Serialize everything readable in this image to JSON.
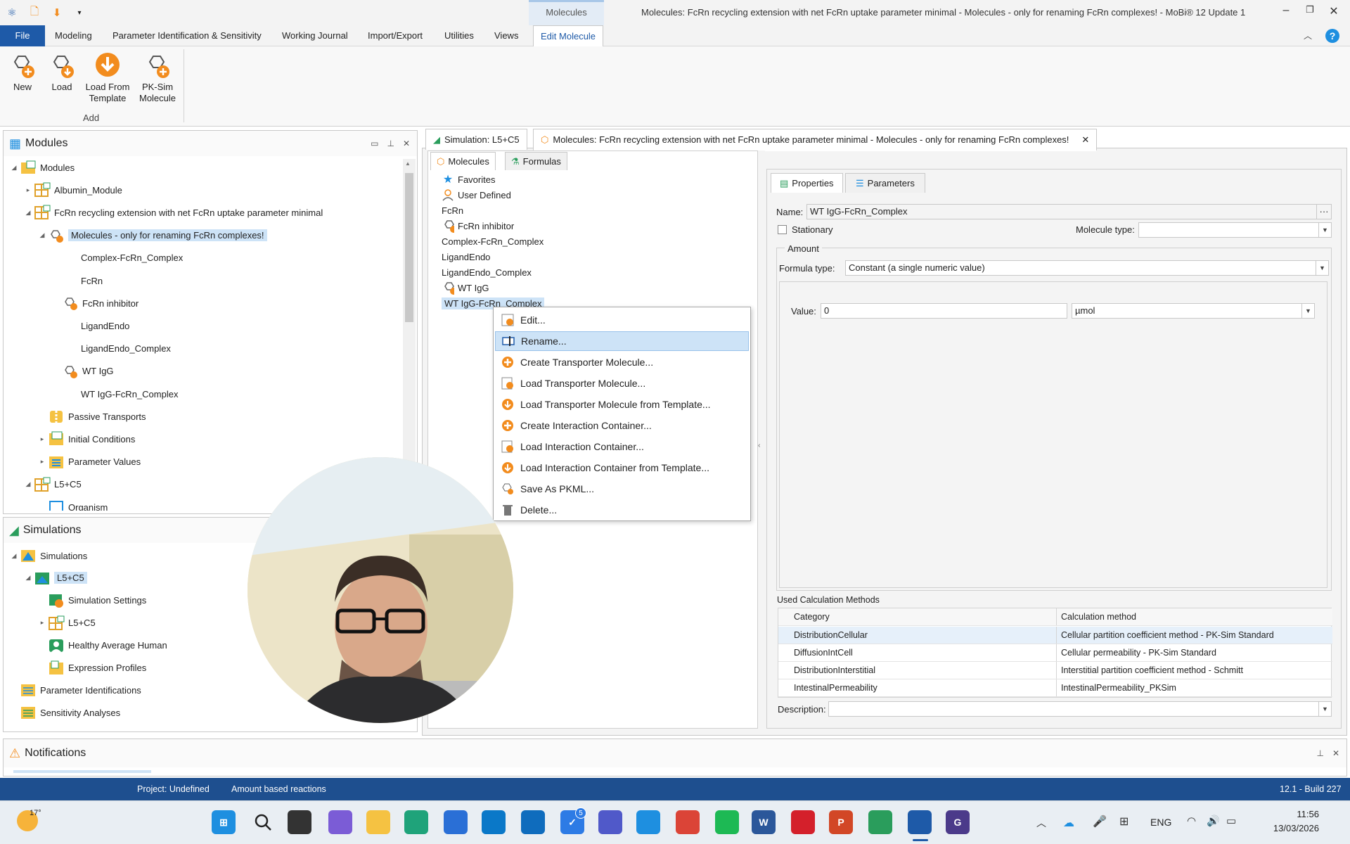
{
  "window": {
    "title": "Molecules: FcRn recycling extension with net FcRn uptake parameter minimal - Molecules - only for renaming FcRn complexes! - MoBi® 12 Update 1",
    "context_tab": "Molecules"
  },
  "menu": {
    "file": "File",
    "items": [
      "Modeling",
      "Parameter Identification & Sensitivity",
      "Working Journal",
      "Import/Export",
      "Utilities",
      "Views",
      "Edit Molecule"
    ]
  },
  "ribbon": {
    "buttons": [
      "New",
      "Load",
      "Load From\nTemplate",
      "PK-Sim\nMolecule"
    ],
    "group_label": "Add"
  },
  "modules_panel": {
    "title": "Modules",
    "tree": [
      {
        "label": "Modules",
        "level": 0,
        "expanded": true,
        "icon": "modules-folder-icon"
      },
      {
        "label": "Albumin_Module",
        "level": 1,
        "expanded": false,
        "icon": "module-icon"
      },
      {
        "label": "FcRn recycling extension with net FcRn uptake parameter minimal",
        "level": 1,
        "expanded": true,
        "icon": "module-icon"
      },
      {
        "label": "Molecules - only for renaming FcRn complexes!",
        "level": 2,
        "expanded": true,
        "selected": true,
        "icon": "molecule-icon"
      },
      {
        "label": "Complex-FcRn_Complex",
        "level": 3
      },
      {
        "label": "FcRn",
        "level": 3
      },
      {
        "label": "FcRn inhibitor",
        "level": 3,
        "icon": "molecule-icon"
      },
      {
        "label": "LigandEndo",
        "level": 3
      },
      {
        "label": "LigandEndo_Complex",
        "level": 3
      },
      {
        "label": "WT IgG",
        "level": 3,
        "icon": "molecule-icon"
      },
      {
        "label": "WT IgG-FcRn_Complex",
        "level": 3
      },
      {
        "label": "Passive Transports",
        "level": 2,
        "icon": "transport-icon"
      },
      {
        "label": "Initial Conditions",
        "level": 2,
        "expanded": false,
        "icon": "initial-conditions-icon"
      },
      {
        "label": "Parameter Values",
        "level": 2,
        "expanded": false,
        "icon": "parameter-values-icon"
      },
      {
        "label": "L5+C5",
        "level": 1,
        "expanded": true,
        "icon": "module-icon"
      },
      {
        "label": "Organism",
        "level": 2,
        "icon": "organism-icon"
      }
    ]
  },
  "simulations_panel": {
    "title": "Simulations",
    "tree": [
      {
        "label": "Simulations",
        "level": 0,
        "expanded": true,
        "icon": "simulations-icon"
      },
      {
        "label": "L5+C5",
        "level": 1,
        "expanded": true,
        "selected": true,
        "icon": "simulation-icon"
      },
      {
        "label": "Simulation Settings",
        "level": 2,
        "icon": "settings-icon"
      },
      {
        "label": "L5+C5",
        "level": 2,
        "expanded": false,
        "icon": "module-icon"
      },
      {
        "label": "Healthy Average Human",
        "level": 2,
        "icon": "individual-icon"
      },
      {
        "label": "Expression Profiles",
        "level": 2,
        "icon": "expression-icon"
      },
      {
        "label": "Parameter Identifications",
        "level": 0,
        "icon": "parameter-identification-icon"
      },
      {
        "label": "Sensitivity Analyses",
        "level": 0,
        "icon": "sensitivity-icon"
      }
    ]
  },
  "notifications": {
    "title": "Notifications"
  },
  "doc_tabs": [
    {
      "label": "Simulation: L5+C5"
    },
    {
      "label": "Molecules: FcRn recycling extension with net FcRn uptake parameter minimal - Molecules - only for renaming FcRn complexes!"
    }
  ],
  "sub_tabs": [
    "Molecules",
    "Formulas"
  ],
  "molecule_list": [
    {
      "label": "Favorites",
      "icon": "star-icon"
    },
    {
      "label": "User Defined",
      "icon": "user-defined-icon"
    },
    {
      "label": "FcRn"
    },
    {
      "label": "FcRn inhibitor",
      "icon": "molecule-icon"
    },
    {
      "label": "Complex-FcRn_Complex"
    },
    {
      "label": "LigandEndo"
    },
    {
      "label": "LigandEndo_Complex"
    },
    {
      "label": "WT IgG",
      "icon": "molecule-icon"
    },
    {
      "label": "WT IgG-FcRn_Complex",
      "selected": true
    }
  ],
  "context_menu": [
    {
      "label": "Edit...",
      "icon": "edit-icon"
    },
    {
      "label": "Rename...",
      "icon": "rename-icon",
      "highlighted": true
    },
    {
      "label": "Create Transporter Molecule...",
      "icon": "create-icon"
    },
    {
      "label": "Load Transporter Molecule...",
      "icon": "load-icon"
    },
    {
      "label": "Load Transporter Molecule from Template...",
      "icon": "template-icon"
    },
    {
      "label": "Create Interaction Container...",
      "icon": "create-icon"
    },
    {
      "label": "Load Interaction Container...",
      "icon": "load-icon"
    },
    {
      "label": "Load Interaction Container from Template...",
      "icon": "template-icon"
    },
    {
      "label": "Save As PKML...",
      "icon": "save-pkml-icon"
    },
    {
      "label": "Delete...",
      "icon": "trash-icon"
    }
  ],
  "properties": {
    "tabs": [
      "Properties",
      "Parameters"
    ],
    "name_label": "Name:",
    "name_value": "WT IgG-FcRn_Complex",
    "stationary_label": "Stationary",
    "molecule_type_label": "Molecule type:",
    "molecule_type_value": "",
    "amount_label": "Amount",
    "formula_type_label": "Formula type:",
    "formula_type_value": "Constant (a single numeric value)",
    "value_label": "Value:",
    "value": "0",
    "unit": "µmol",
    "used_calc_label": "Used Calculation Methods",
    "calc_headers": [
      "Category",
      "Calculation method"
    ],
    "calc_rows": [
      [
        "DistributionCellular",
        "Cellular partition coefficient method - PK-Sim Standard"
      ],
      [
        "DiffusionIntCell",
        "Cellular permeability - PK-Sim Standard"
      ],
      [
        "DistributionInterstitial",
        "Interstitial partition coefficient method - Schmitt"
      ],
      [
        "IntestinalPermeability",
        "IntestinalPermeability_PKSim"
      ]
    ],
    "description_label": "Description:",
    "description_value": ""
  },
  "statusbar": {
    "project": "Project: Undefined",
    "mode": "Amount based reactions",
    "build": "12.1 - Build 227"
  },
  "taskbar": {
    "weather": "17°",
    "language": "ENG",
    "time": "11:56",
    "date": "13/03/2026",
    "todo_badge": "5"
  },
  "colors": {
    "accent": "#1e5aa8",
    "status_bar": "#1e4f8f",
    "selection": "#cde3f7",
    "orange_icon": "#f28c1e"
  }
}
